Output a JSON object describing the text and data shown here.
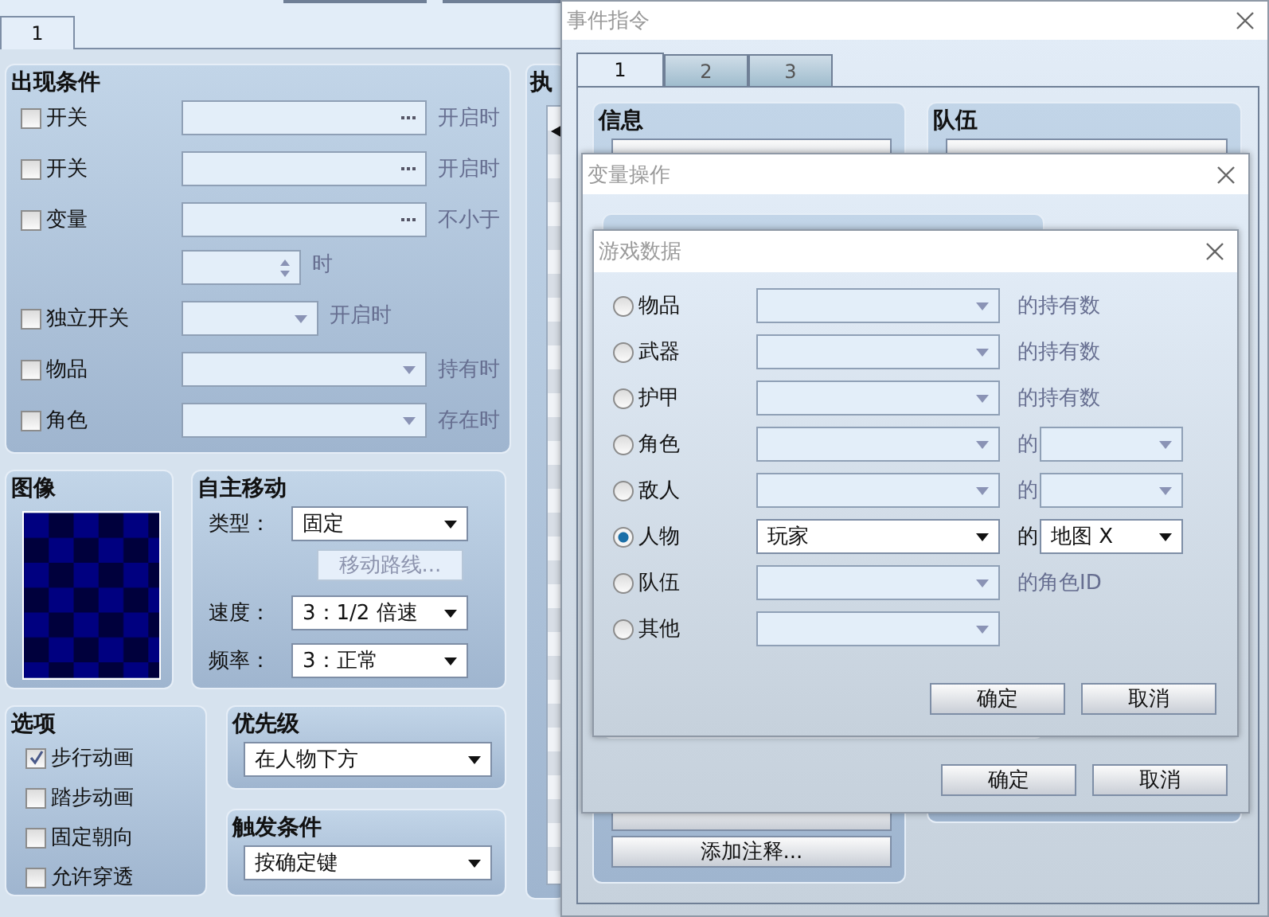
{
  "main_window": {
    "tabs": [
      {
        "label": "1",
        "selected": true
      }
    ],
    "conditions": {
      "title": "出现条件",
      "rows": [
        {
          "kind": "ellipsis",
          "label": "开关",
          "checked": false,
          "suffix": "开启时"
        },
        {
          "kind": "ellipsis",
          "label": "开关",
          "checked": false,
          "suffix": "开启时"
        },
        {
          "kind": "ellipsis",
          "label": "变量",
          "checked": false,
          "suffix": "不小于"
        },
        {
          "kind": "spin",
          "disabled": true,
          "suffix": "时"
        },
        {
          "kind": "short_combo",
          "label": "独立开关",
          "checked": false,
          "suffix": "开启时"
        },
        {
          "kind": "combo",
          "label": "物品",
          "checked": false,
          "suffix": "持有时"
        },
        {
          "kind": "combo",
          "label": "角色",
          "checked": false,
          "suffix": "存在时"
        }
      ]
    },
    "image": {
      "title": "图像"
    },
    "movement": {
      "title": "自主移动",
      "type_label": "类型：",
      "type_value": "固定",
      "route_button": {
        "label": "移动路线...",
        "disabled": true
      },
      "speed_label": "速度：",
      "speed_value": "3：1/2 倍速",
      "frequency_label": "频率：",
      "frequency_value": "3：正常"
    },
    "options": {
      "title": "选项",
      "items": [
        {
          "label": "步行动画",
          "checked": true
        },
        {
          "label": "踏步动画",
          "checked": false
        },
        {
          "label": "固定朝向",
          "checked": false
        },
        {
          "label": "允许穿透",
          "checked": false
        }
      ]
    },
    "priority": {
      "title": "优先级",
      "value": "在人物下方"
    },
    "trigger": {
      "title": "触发条件",
      "value": "按确定键"
    },
    "contents": {
      "title": "执"
    }
  },
  "command_window": {
    "title": "事件指令",
    "tabs": [
      {
        "label": "1",
        "selected": true
      },
      {
        "label": "2",
        "selected": false
      },
      {
        "label": "3",
        "selected": false
      }
    ],
    "groups": [
      {
        "title": "信息",
        "bottom_buttons": [
          "添加注释..."
        ]
      },
      {
        "title": "队伍"
      }
    ]
  },
  "variable_dialog": {
    "title": "变量操作",
    "buttons": [
      "确定",
      "取消"
    ]
  },
  "game_data_dialog": {
    "title": "游戏数据",
    "rows": [
      {
        "kind": "count",
        "label": "物品",
        "selected": false,
        "suffix": "的持有数"
      },
      {
        "kind": "count",
        "label": "武器",
        "selected": false,
        "suffix": "的持有数"
      },
      {
        "kind": "count",
        "label": "护甲",
        "selected": false,
        "suffix": "的持有数"
      },
      {
        "kind": "attribute",
        "label": "角色",
        "selected": false,
        "of": "的"
      },
      {
        "kind": "attribute",
        "label": "敌人",
        "selected": false,
        "of": "的"
      },
      {
        "kind": "attribute",
        "label": "人物",
        "selected": true,
        "value": "玩家",
        "of": "的",
        "attribute_value": "地图 X"
      },
      {
        "kind": "count",
        "label": "队伍",
        "selected": false,
        "suffix": "的角色ID"
      },
      {
        "kind": "plain",
        "label": "其他",
        "selected": false
      }
    ],
    "buttons": [
      "确定",
      "取消"
    ]
  }
}
